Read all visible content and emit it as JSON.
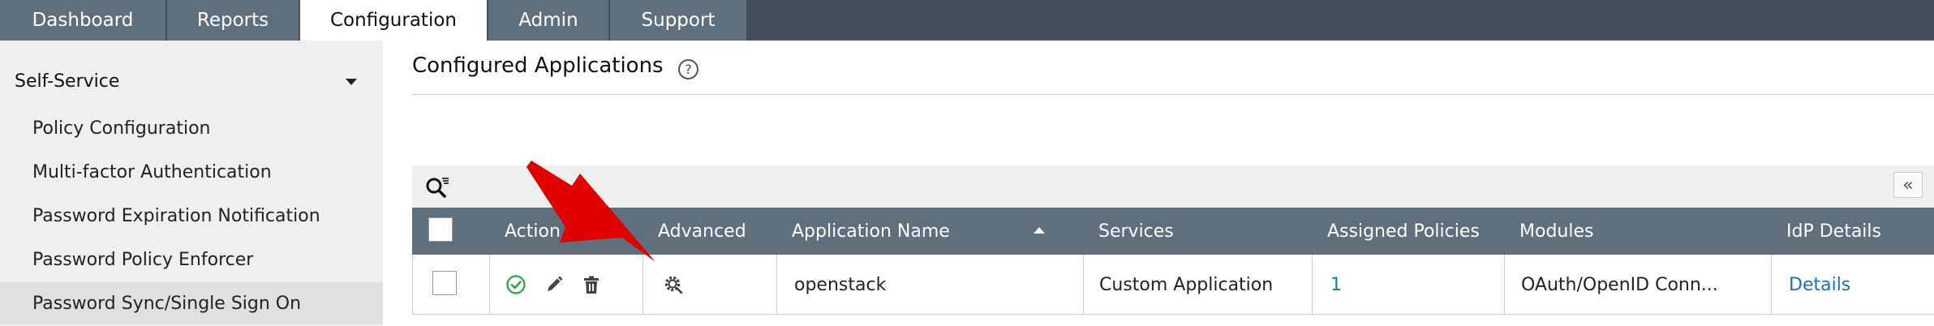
{
  "topnav": {
    "tabs": [
      {
        "label": "Dashboard"
      },
      {
        "label": "Reports"
      },
      {
        "label": "Configuration",
        "active": true
      },
      {
        "label": "Admin"
      },
      {
        "label": "Support"
      }
    ]
  },
  "sidebar": {
    "header": "Self-Service",
    "items": [
      {
        "label": "Policy Configuration"
      },
      {
        "label": "Multi-factor Authentication"
      },
      {
        "label": "Password Expiration Notification"
      },
      {
        "label": "Password Policy Enforcer"
      },
      {
        "label": "Password Sync/Single Sign On",
        "selected": true
      }
    ]
  },
  "main": {
    "title": "Configured Applications",
    "help_glyph": "?",
    "collapse_glyph": "«",
    "table": {
      "headers": [
        "Action",
        "Advanced",
        "Application Name",
        "Services",
        "Assigned Policies",
        "Modules",
        "IdP Details"
      ],
      "sorted_column": "Application Name",
      "sort_direction": "ascending",
      "rows": [
        {
          "application_name": "openstack",
          "services": "Custom Application",
          "assigned_policies": "1",
          "modules": "OAuth/OpenID Conn...",
          "idp_details": "Details"
        }
      ]
    }
  },
  "colors": {
    "nav_bg": "#43505a",
    "tab_bg": "#5f6f7b",
    "header_bg": "#5f6f7b",
    "link": "#1a73b8",
    "enable_icon": "#3aa54a",
    "annotation_arrow": "#e00000"
  },
  "icons": [
    "search-filter-icon",
    "collapse-icon",
    "enable-check-icon",
    "edit-pencil-icon",
    "delete-trash-icon",
    "advanced-settings-gear-icon",
    "help-icon"
  ]
}
